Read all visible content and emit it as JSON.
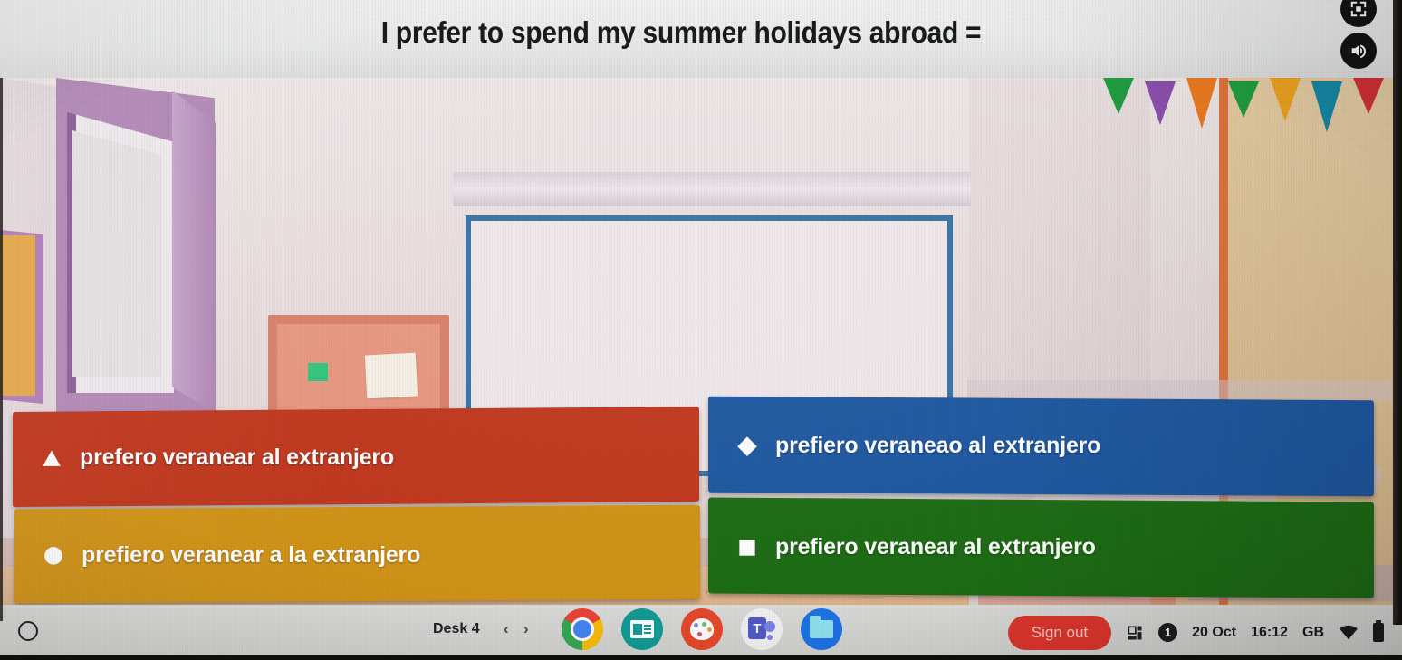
{
  "quiz": {
    "question": "I prefer to spend my summer holidays abroad =",
    "answers": [
      {
        "label": "prefero veranear al extranjero",
        "shape": "triangle-icon",
        "color": "#C0351B"
      },
      {
        "label": "prefiero veraneao al extranjero",
        "shape": "diamond-icon",
        "color": "#1C56A0"
      },
      {
        "label": "prefiero veranear a la extranjero",
        "shape": "circle-icon",
        "color": "#D19214"
      },
      {
        "label": "prefiero veranear al extranjero",
        "shape": "square-icon",
        "color": "#1B6B12"
      }
    ]
  },
  "controls": {
    "fullscreen": "fullscreen-icon",
    "sound": "sound-on-icon"
  },
  "shelf": {
    "launcher": "launcher-circle-icon",
    "desk_label": "Desk 4",
    "desk_prev": "‹",
    "desk_next": "›",
    "apps": [
      {
        "name": "chrome-icon"
      },
      {
        "name": "news-icon"
      },
      {
        "name": "palette-icon"
      },
      {
        "name": "teams-icon"
      },
      {
        "name": "files-icon"
      }
    ],
    "sign_out_label": "Sign out",
    "window_icon": "window-grid-icon",
    "notification_count": "1",
    "date": "20 Oct",
    "time": "16:12",
    "keyboard_layout": "GB",
    "wifi": "wifi-icon",
    "battery": "battery-icon"
  },
  "scene": {
    "bunting_colors": [
      "#1f9e3e",
      "#8b4fae",
      "#ef7a1f",
      "#1f9e3e",
      "#f0a51d",
      "#1389a8",
      "#d42f35"
    ]
  }
}
